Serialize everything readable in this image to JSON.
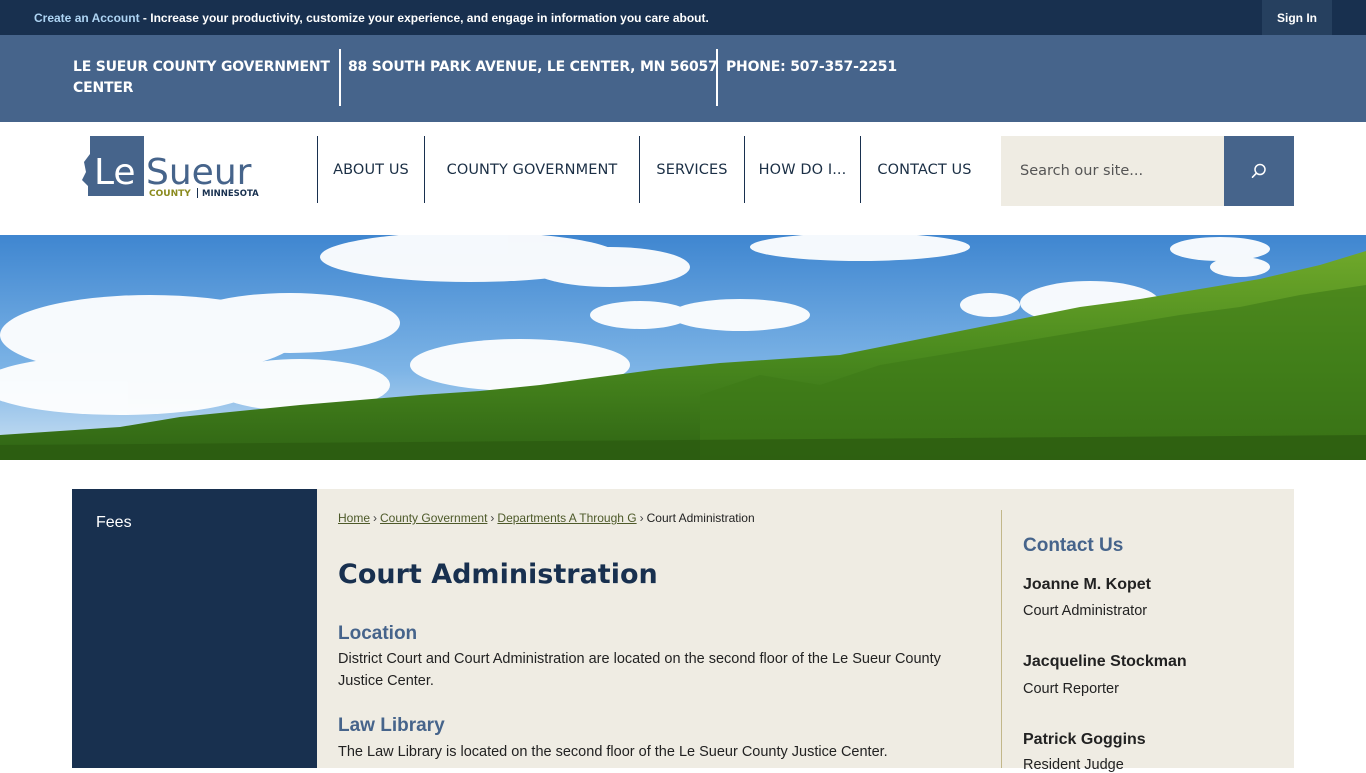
{
  "topbar": {
    "create_account_link": "Create an Account",
    "create_account_text": " - Increase your productivity, customize your experience, and engage in information you care about.",
    "sign_in": "Sign In"
  },
  "infobar": {
    "name_line1": "LE SUEUR COUNTY GOVERNMENT",
    "name_line2": "CENTER",
    "address": "88 SOUTH PARK AVENUE, LE CENTER, MN 56057",
    "phone": "PHONE: 507-357-2251"
  },
  "logo": {
    "word1": "Le",
    "word2": "Sueur",
    "county": "COUNTY",
    "state": "MINNESOTA"
  },
  "nav": {
    "items": [
      "ABOUT US",
      "COUNTY GOVERNMENT",
      "SERVICES",
      "HOW DO I...",
      "CONTACT US"
    ]
  },
  "search": {
    "placeholder": "Search our site..."
  },
  "sidebar": {
    "items": [
      "Fees"
    ]
  },
  "breadcrumb": {
    "home": "Home",
    "level1": "County Government",
    "level2": "Departments A Through G",
    "current": "Court Administration",
    "separator": "›"
  },
  "main": {
    "title": "Court Administration",
    "sections": [
      {
        "heading": "Location",
        "line1": "District Court and Court Administration are located on the second floor of the Le Sueur County",
        "line2": "Justice Center."
      },
      {
        "heading": "Law Library",
        "line1": "The Law Library is located on the second floor of the Le Sueur County Justice Center."
      }
    ]
  },
  "contact": {
    "heading": "Contact Us",
    "people": [
      {
        "name": "Joanne M. Kopet",
        "role": "Court Administrator"
      },
      {
        "name": "Jacqueline Stockman",
        "role": "Court Reporter"
      },
      {
        "name": "Patrick Goggins",
        "role": "Resident Judge"
      }
    ]
  },
  "colors": {
    "navy": "#18304f",
    "slate_blue": "#46648b",
    "cream": "#efece3",
    "olive": "#8a8a1e"
  }
}
